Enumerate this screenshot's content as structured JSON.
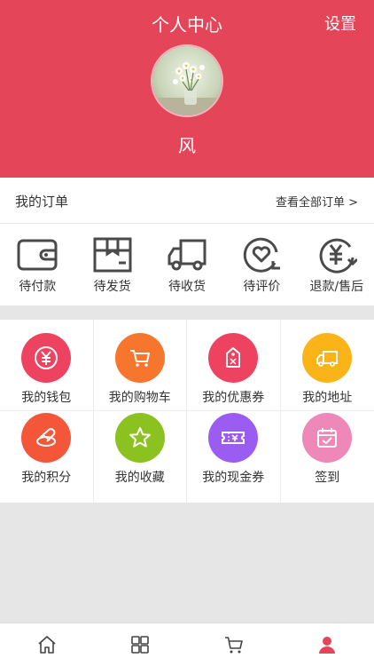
{
  "header": {
    "title": "个人中心",
    "settings_label": "设置",
    "username": "风",
    "background_color": "#e54558"
  },
  "orders": {
    "title": "我的订单",
    "view_all": "查看全部订单 >",
    "items": [
      {
        "label": "待付款",
        "icon": "wallet-icon"
      },
      {
        "label": "待发货",
        "icon": "package-icon"
      },
      {
        "label": "待收货",
        "icon": "truck-icon"
      },
      {
        "label": "待评价",
        "icon": "heart-review-icon"
      },
      {
        "label": "退款/售后",
        "icon": "yen-refund-icon"
      }
    ]
  },
  "services": {
    "items": [
      {
        "label": "我的钱包",
        "icon": "yen-icon",
        "color": "#ee4360"
      },
      {
        "label": "我的购物车",
        "icon": "cart-icon",
        "color": "#f7762e"
      },
      {
        "label": "我的优惠券",
        "icon": "tag-icon",
        "color": "#ee4360"
      },
      {
        "label": "我的地址",
        "icon": "truck-icon",
        "color": "#fbb418"
      },
      {
        "label": "我的积分",
        "icon": "coins-icon",
        "color": "#f4563a"
      },
      {
        "label": "我的收藏",
        "icon": "star-icon",
        "color": "#8cc21f"
      },
      {
        "label": "我的现金券",
        "icon": "ticket-icon",
        "color": "#9b5cf2"
      },
      {
        "label": "签到",
        "icon": "calendar-check-icon",
        "color": "#ee88b8"
      }
    ]
  },
  "tabbar": {
    "items": [
      {
        "name": "home-icon",
        "active": false
      },
      {
        "name": "grid-icon",
        "active": false
      },
      {
        "name": "cart-icon",
        "active": false
      },
      {
        "name": "user-icon",
        "active": true
      }
    ],
    "active_color": "#e54558"
  }
}
